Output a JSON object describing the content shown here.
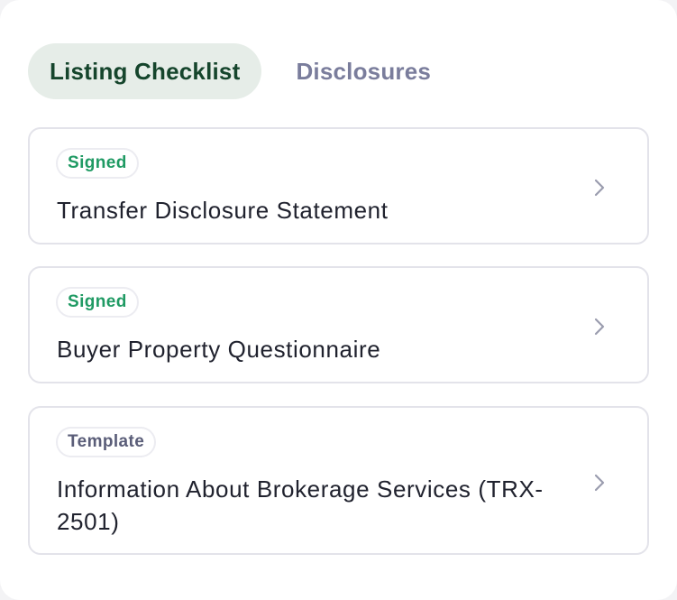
{
  "tabs": [
    {
      "label": "Listing Checklist",
      "active": true
    },
    {
      "label": "Disclosures",
      "active": false
    }
  ],
  "documents": [
    {
      "status": "Signed",
      "title": "Transfer Disclosure Statement"
    },
    {
      "status": "Signed",
      "title": "Buyer Property Questionnaire"
    },
    {
      "status": "Template",
      "title": "Information About Brokerage Services (TRX-2501)"
    }
  ],
  "colors": {
    "active_tab_bg": "#e6ede8",
    "active_tab_text": "#15452c",
    "inactive_tab_text": "#7a7d9c",
    "signed": "#1f9a63",
    "template": "#5a5d78"
  },
  "icons": {
    "chevron": "chevron-right-icon"
  }
}
